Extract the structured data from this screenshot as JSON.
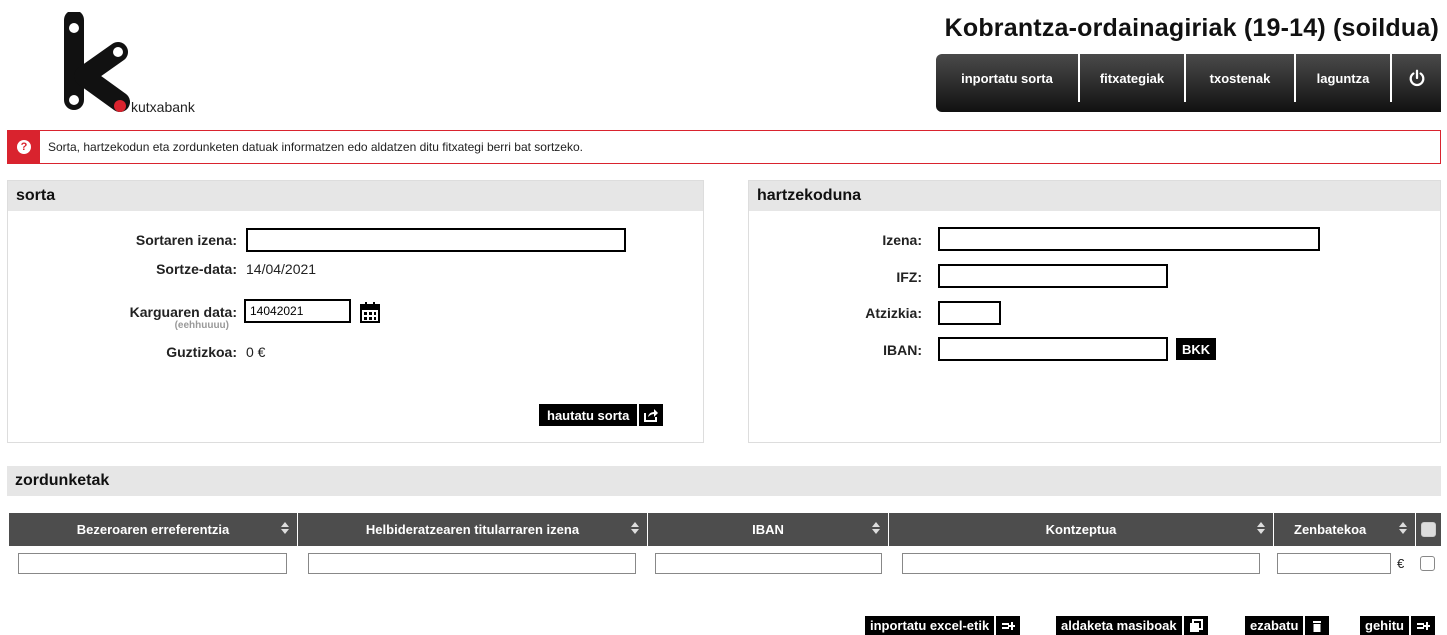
{
  "brand": {
    "name": "kutxabank",
    "accent": "#d9232e"
  },
  "header": {
    "title": "Kobrantza-ordainagiriak (19-14) (soildua)"
  },
  "nav": {
    "items": [
      {
        "label": "inportatu sorta"
      },
      {
        "label": "fitxategiak"
      },
      {
        "label": "txostenak"
      },
      {
        "label": "laguntza"
      }
    ],
    "power_icon": "power-icon"
  },
  "info": {
    "text": "Sorta, hartzekodun eta zordunketen datuak informatzen edo aldatzen ditu fitxategi berri bat sortzeko.",
    "icon": "question-icon"
  },
  "sorta": {
    "title": "sorta",
    "name_label": "Sortaren izena:",
    "name_value": "",
    "created_label": "Sortze-data:",
    "created_value": "14/04/2021",
    "charge_label": "Karguaren data:",
    "charge_hint": "(eehhuuuu)",
    "charge_value": "14042021",
    "total_label": "Guztizkoa:",
    "total_value": "0 €",
    "select_button": "hautatu sorta"
  },
  "creditor": {
    "title": "hartzekoduna",
    "name_label": "Izena:",
    "ifz_label": "IFZ:",
    "suffix_label": "Atzizkia:",
    "iban_label": "IBAN:",
    "bkk_button": "BKK"
  },
  "debits": {
    "title": "zordunketak",
    "columns": [
      "Bezeroaren erreferentzia",
      "Helbideratzearen titularraren izena",
      "IBAN",
      "Kontzeptua",
      "Zenbatekoa"
    ],
    "currency": "€"
  },
  "actions": [
    {
      "label": "inportatu excel-etik",
      "icon": "import-list-icon"
    },
    {
      "label": "aldaketa masiboak",
      "icon": "copy-icon"
    },
    {
      "label": "ezabatu",
      "icon": "trash-icon"
    },
    {
      "label": "gehitu",
      "icon": "add-list-icon"
    }
  ]
}
